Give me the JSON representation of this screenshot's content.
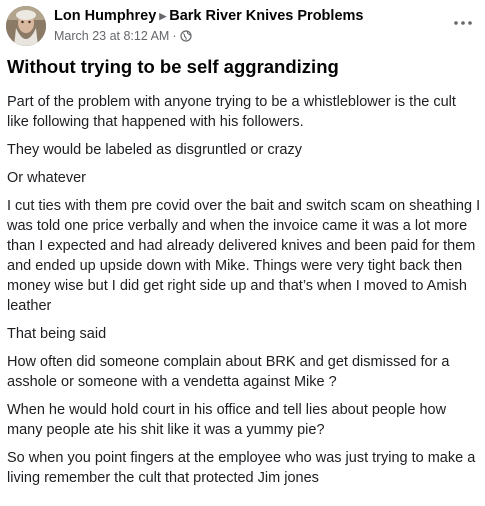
{
  "post": {
    "author": "Lon Humphrey",
    "group": "Bark River Knives Problems",
    "timestamp": "March 23 at 8:12 AM",
    "separator": "·",
    "audience_icon": "globe-icon",
    "more_icon": "more-horizontal-icon",
    "title": "Without trying to be self aggrandizing",
    "paragraphs": [
      "Part of the problem with anyone trying to be a whistleblower is the cult like following that happened with his followers.",
      "They would be labeled as disgruntled or crazy",
      "Or whatever",
      "I cut ties with them pre covid over the bait and switch scam on sheathing I was told one price verbally and when the invoice came it was a lot more than I expected and had already delivered knives and been paid for them and ended up upside down with Mike. Things were very tight back then money wise but I did get right side up and that’s when I moved to Amish leather",
      "That being said",
      "How often did someone complain about BRK and get dismissed for a asshole or someone with a vendetta against Mike ?",
      "When he would hold court in his office and tell lies about people how many people ate his shit like it was a yummy pie?",
      "So when you point fingers at the employee who was just trying to make a living remember the cult that protected Jim jones"
    ]
  },
  "colors": {
    "text_primary": "#050505",
    "text_secondary": "#65676b",
    "background": "#ffffff"
  }
}
